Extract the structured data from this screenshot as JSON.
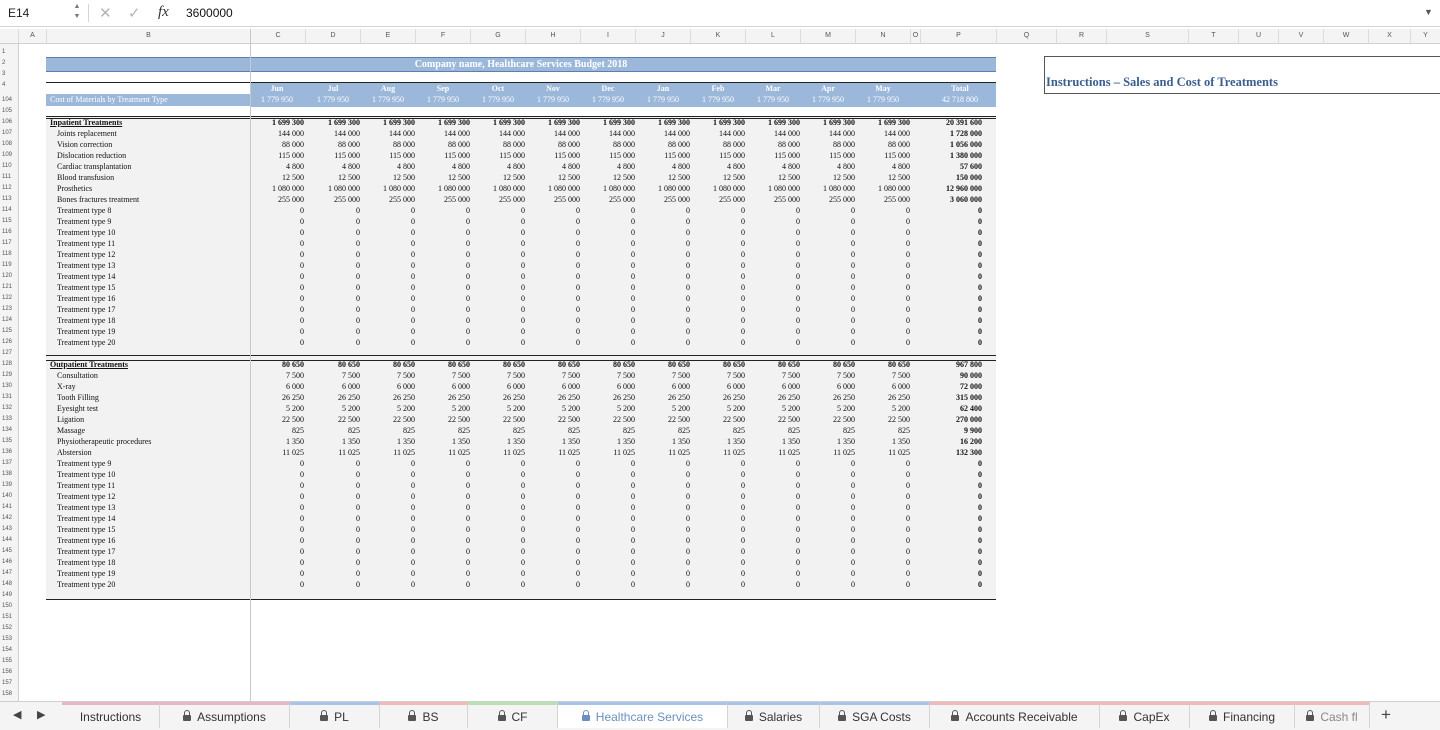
{
  "formula_bar": {
    "cell_ref": "E14",
    "formula": "3600000",
    "fx_label": "fx",
    "cancel_icon": "✕",
    "enter_icon": "✓"
  },
  "column_headers": [
    "A",
    "B",
    "C",
    "D",
    "E",
    "F",
    "G",
    "H",
    "I",
    "J",
    "K",
    "L",
    "M",
    "N",
    "O",
    "P",
    "Q",
    "R",
    "S",
    "T",
    "U",
    "V",
    "W",
    "X",
    "Y"
  ],
  "top_row_numbers": [
    "1",
    "2",
    "3",
    "4",
    "104",
    "105"
  ],
  "sheet": {
    "title": "Company name, Healthcare Services Budget 2018",
    "months": [
      "Jun",
      "Jul",
      "Aug",
      "Sep",
      "Oct",
      "Nov",
      "Dec",
      "Jan",
      "Feb",
      "Mar",
      "Apr",
      "May"
    ],
    "total_label": "Total",
    "monthly_totals": [
      "1 779 950",
      "1 779 950",
      "1 779 950",
      "1 779 950",
      "1 779 950",
      "1 779 950",
      "1 779 950",
      "1 779 950",
      "1 779 950",
      "1 779 950",
      "1 779 950",
      "1 779 950"
    ],
    "grand_total": "42 718 800",
    "cost_label": "Cost of Materials by Treatment Type",
    "instructions_title": "Instructions – Sales and Cost of Treatments",
    "inpatient": {
      "header": "Inpatient Treatments",
      "header_value": "1 699 300",
      "header_total": "20 391 600",
      "rows": [
        {
          "r": "107",
          "label": "Joints replacement",
          "value": "144 000",
          "total": "1 728 000"
        },
        {
          "r": "108",
          "label": "Vision correction",
          "value": "88 000",
          "total": "1 056 000"
        },
        {
          "r": "109",
          "label": "Dislocation reduction",
          "value": "115 000",
          "total": "1 380 000"
        },
        {
          "r": "110",
          "label": "Cardiac transplantation",
          "value": "4 800",
          "total": "57 600"
        },
        {
          "r": "111",
          "label": "Blood transfusion",
          "value": "12 500",
          "total": "150 000"
        },
        {
          "r": "112",
          "label": "Prosthetics",
          "value": "1 080 000",
          "total": "12 960 000"
        },
        {
          "r": "113",
          "label": "Bones fractures treatment",
          "value": "255 000",
          "total": "3 060 000"
        },
        {
          "r": "114",
          "label": "Treatment type 8",
          "value": "0",
          "total": "0"
        },
        {
          "r": "115",
          "label": "Treatment type 9",
          "value": "0",
          "total": "0"
        },
        {
          "r": "116",
          "label": "Treatment type 10",
          "value": "0",
          "total": "0"
        },
        {
          "r": "117",
          "label": "Treatment type 11",
          "value": "0",
          "total": "0"
        },
        {
          "r": "118",
          "label": "Treatment type 12",
          "value": "0",
          "total": "0"
        },
        {
          "r": "119",
          "label": "Treatment type 13",
          "value": "0",
          "total": "0"
        },
        {
          "r": "120",
          "label": "Treatment type 14",
          "value": "0",
          "total": "0"
        },
        {
          "r": "121",
          "label": "Treatment type 15",
          "value": "0",
          "total": "0"
        },
        {
          "r": "122",
          "label": "Treatment type 16",
          "value": "0",
          "total": "0"
        },
        {
          "r": "123",
          "label": "Treatment type 17",
          "value": "0",
          "total": "0"
        },
        {
          "r": "124",
          "label": "Treatment type 18",
          "value": "0",
          "total": "0"
        },
        {
          "r": "125",
          "label": "Treatment type 19",
          "value": "0",
          "total": "0"
        },
        {
          "r": "126",
          "label": "Treatment type 20",
          "value": "0",
          "total": "0"
        }
      ]
    },
    "outpatient": {
      "header": "Outpatient Treatments",
      "header_value": "80 650",
      "header_total": "967 800",
      "rows": [
        {
          "r": "129",
          "label": "Consultation",
          "value": "7 500",
          "total": "90 000"
        },
        {
          "r": "130",
          "label": "X-ray",
          "value": "6 000",
          "total": "72 000"
        },
        {
          "r": "131",
          "label": "Tooth Filling",
          "value": "26 250",
          "total": "315 000"
        },
        {
          "r": "132",
          "label": "Eyesight test",
          "value": "5 200",
          "total": "62 400"
        },
        {
          "r": "133",
          "label": "Ligation",
          "value": "22 500",
          "total": "270 000"
        },
        {
          "r": "134",
          "label": "Massage",
          "value": "825",
          "total": "9 900"
        },
        {
          "r": "135",
          "label": "Physiotherapeutic procedures",
          "value": "1 350",
          "total": "16 200"
        },
        {
          "r": "136",
          "label": "Abstersion",
          "value": "11 025",
          "total": "132 300"
        },
        {
          "r": "137",
          "label": "Treatment type 9",
          "value": "0",
          "total": "0"
        },
        {
          "r": "138",
          "label": "Treatment type 10",
          "value": "0",
          "total": "0"
        },
        {
          "r": "139",
          "label": "Treatment type 11",
          "value": "0",
          "total": "0"
        },
        {
          "r": "140",
          "label": "Treatment type 12",
          "value": "0",
          "total": "0"
        },
        {
          "r": "141",
          "label": "Treatment type 13",
          "value": "0",
          "total": "0"
        },
        {
          "r": "142",
          "label": "Treatment type 14",
          "value": "0",
          "total": "0"
        },
        {
          "r": "143",
          "label": "Treatment type 15",
          "value": "0",
          "total": "0"
        },
        {
          "r": "144",
          "label": "Treatment type 16",
          "value": "0",
          "total": "0"
        },
        {
          "r": "145",
          "label": "Treatment type 17",
          "value": "0",
          "total": "0"
        },
        {
          "r": "146",
          "label": "Treatment type 18",
          "value": "0",
          "total": "0"
        },
        {
          "r": "147",
          "label": "Treatment type 19",
          "value": "0",
          "total": "0"
        },
        {
          "r": "148",
          "label": "Treatment type 20",
          "value": "0",
          "total": "0"
        }
      ]
    },
    "trailing_rows": [
      "149",
      "150",
      "151",
      "152",
      "153",
      "154",
      "155",
      "156",
      "157",
      "158"
    ]
  },
  "tabs": [
    {
      "label": "Instructions",
      "locked": false,
      "active": false,
      "accent": "#e8b4c8"
    },
    {
      "label": "Assumptions",
      "locked": true,
      "active": false,
      "accent": "#e8b4c8"
    },
    {
      "label": "PL",
      "locked": true,
      "active": false,
      "accent": "#a8c4e8"
    },
    {
      "label": "BS",
      "locked": true,
      "active": false,
      "accent": "#f0b8b8"
    },
    {
      "label": "CF",
      "locked": true,
      "active": false,
      "accent": "#b8e0b0"
    },
    {
      "label": "Healthcare Services",
      "locked": true,
      "active": true,
      "accent": "#a8c4e8"
    },
    {
      "label": "Salaries",
      "locked": true,
      "active": false,
      "accent": "#a8c4e8"
    },
    {
      "label": "SGA Costs",
      "locked": true,
      "active": false,
      "accent": "#a8c4e8"
    },
    {
      "label": "Accounts Receivable",
      "locked": true,
      "active": false,
      "accent": "#f0b8b8"
    },
    {
      "label": "CapEx",
      "locked": true,
      "active": false,
      "accent": "#f0b8b8"
    },
    {
      "label": "Financing",
      "locked": true,
      "active": false,
      "accent": "#f0b8b8"
    },
    {
      "label": "Cash fl",
      "locked": true,
      "active": false,
      "accent": "#f0b8b8"
    }
  ],
  "nav": {
    "prev": "◀",
    "next": "▶",
    "add": "+"
  },
  "colors": {
    "header_blue": "#9bb8db",
    "active_tab": "#6d8fc0",
    "instructions_title": "#3a5f8f"
  }
}
